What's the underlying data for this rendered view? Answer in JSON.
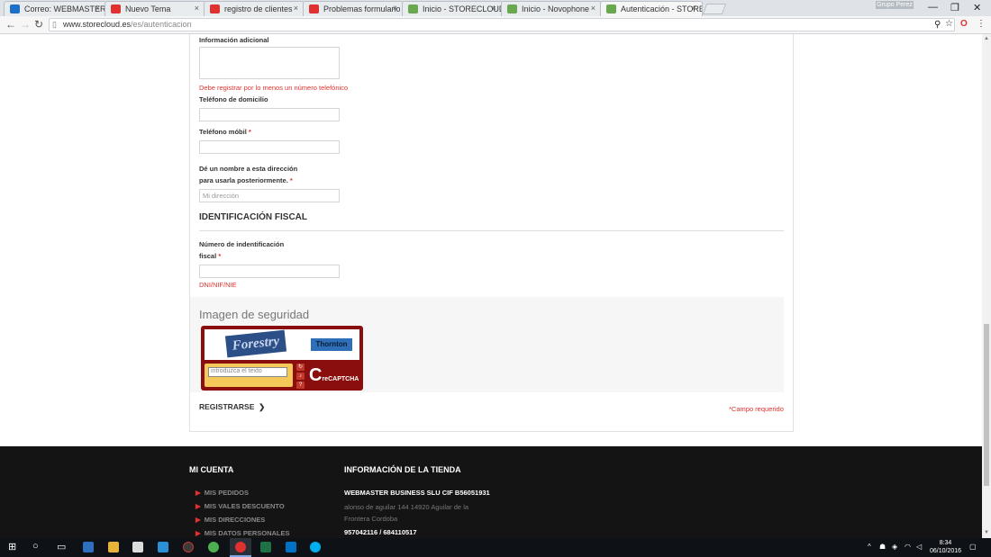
{
  "browser": {
    "tabs": [
      {
        "label": "Correo: WEBMASTER BU",
        "color": "#1e6fc8"
      },
      {
        "label": "Nuevo Tema",
        "color": "#e0312e"
      },
      {
        "label": "registro de clientes",
        "color": "#e0312e"
      },
      {
        "label": "Problemas formulario re",
        "color": "#e0312e"
      },
      {
        "label": "Inicio - STORECLOUD",
        "color": "#6aa84f"
      },
      {
        "label": "Inicio - Novophone",
        "color": "#6aa84f"
      },
      {
        "label": "Autenticación - STOREC",
        "color": "#6aa84f"
      }
    ],
    "close_glyph": "×",
    "user_label": "Grupo Perez",
    "url_domain": "www.storecloud.es",
    "url_path": "/es/autenticacion"
  },
  "form": {
    "additional_info_label": "Información adicional",
    "phone_warning": "Debe registrar por lo menos un número telefónico",
    "home_phone_label": "Teléfono de domicilio",
    "mobile_phone_label": "Teléfono móbil",
    "alias_label_1": "Dé un nombre a esta dirección",
    "alias_label_2": "para usarla posteriormente.",
    "alias_placeholder": "Mi dirección",
    "required_mark": "*",
    "fiscal_title": "IDENTIFICACIÓN FISCAL",
    "nif_label_1": "Número de indentificación",
    "nif_label_2": "fiscal",
    "nif_hint": "DNI/NIF/NIE",
    "captcha_title": "Imagen de seguridad",
    "captcha_word1": "Forestry",
    "captcha_word2": "Thornton",
    "captcha_placeholder": "introduzca el texto",
    "captcha_brand_prefix": "re",
    "captcha_brand": "CAPTCHA",
    "register_label": "REGISTRARSE",
    "register_arrow": "❯",
    "required_note": "Campo requerido"
  },
  "footer": {
    "account_title": "MI CUENTA",
    "account_links": [
      "MIS PEDIDOS",
      "MIS VALES DESCUENTO",
      "MIS DIRECCIONES",
      "MIS DATOS PERSONALES"
    ],
    "store_title": "INFORMACIÓN DE LA TIENDA",
    "company": "WEBMASTER BUSINESS SLU CIF B56051931",
    "address": "alonso de aguilar 144 14920 Aguilar de la Frontera Cordoba",
    "phones": "957042116 / 684110517"
  },
  "taskbar": {
    "time": "8:34",
    "date": "06/10/2016"
  }
}
